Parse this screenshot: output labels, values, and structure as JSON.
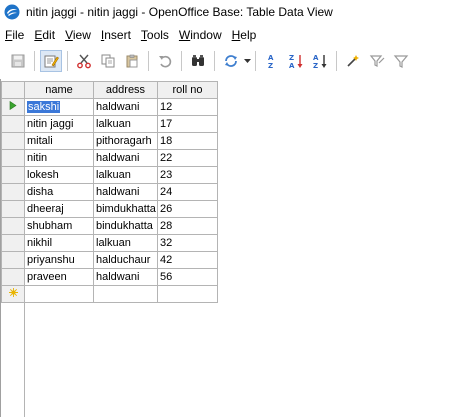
{
  "window": {
    "title": "nitin jaggi - nitin jaggi - OpenOffice Base: Table Data View"
  },
  "menu": [
    {
      "label": "File",
      "accel": "F",
      "rest": "ile"
    },
    {
      "label": "Edit",
      "accel": "E",
      "rest": "dit"
    },
    {
      "label": "View",
      "accel": "V",
      "rest": "iew"
    },
    {
      "label": "Insert",
      "accel": "I",
      "rest": "nsert"
    },
    {
      "label": "Tools",
      "accel": "T",
      "rest": "ools"
    },
    {
      "label": "Window",
      "accel": "W",
      "rest": "indow"
    },
    {
      "label": "Help",
      "accel": "H",
      "rest": "elp"
    }
  ],
  "toolbar": {
    "icons": [
      "save-icon",
      "edit-data-icon",
      "cut-icon",
      "copy-icon",
      "paste-icon",
      "undo-icon",
      "find-record-icon",
      "refresh-icon",
      "sort-ascending-icon",
      "sort-descending-icon",
      "sort-icon",
      "autofilter-icon",
      "standard-filter-icon",
      "apply-filter-icon"
    ]
  },
  "table": {
    "columns": [
      "name",
      "address",
      "roll no"
    ],
    "rows": [
      {
        "name": "sakshi",
        "address": "haldwani",
        "roll": "12"
      },
      {
        "name": "nitin jaggi",
        "address": "lalkuan",
        "roll": "17"
      },
      {
        "name": "mitali",
        "address": "pithoragarh",
        "roll": "18"
      },
      {
        "name": "nitin",
        "address": "haldwani",
        "roll": "22"
      },
      {
        "name": "lokesh",
        "address": "lalkuan",
        "roll": "23"
      },
      {
        "name": "disha",
        "address": "haldwani",
        "roll": "24"
      },
      {
        "name": "dheeraj",
        "address": "bimdukhatta",
        "roll": "26"
      },
      {
        "name": "shubham",
        "address": "bindukhatta",
        "roll": "28"
      },
      {
        "name": "nikhil",
        "address": "lalkuan",
        "roll": "32"
      },
      {
        "name": "priyanshu",
        "address": "halduchaur",
        "roll": "42"
      },
      {
        "name": "praveen",
        "address": "haldwani",
        "roll": "56"
      }
    ]
  },
  "colors": {
    "selection": "#3b78d8",
    "current_row_arrow": "#3aa52f",
    "new_row_marker": "#e8b400"
  }
}
